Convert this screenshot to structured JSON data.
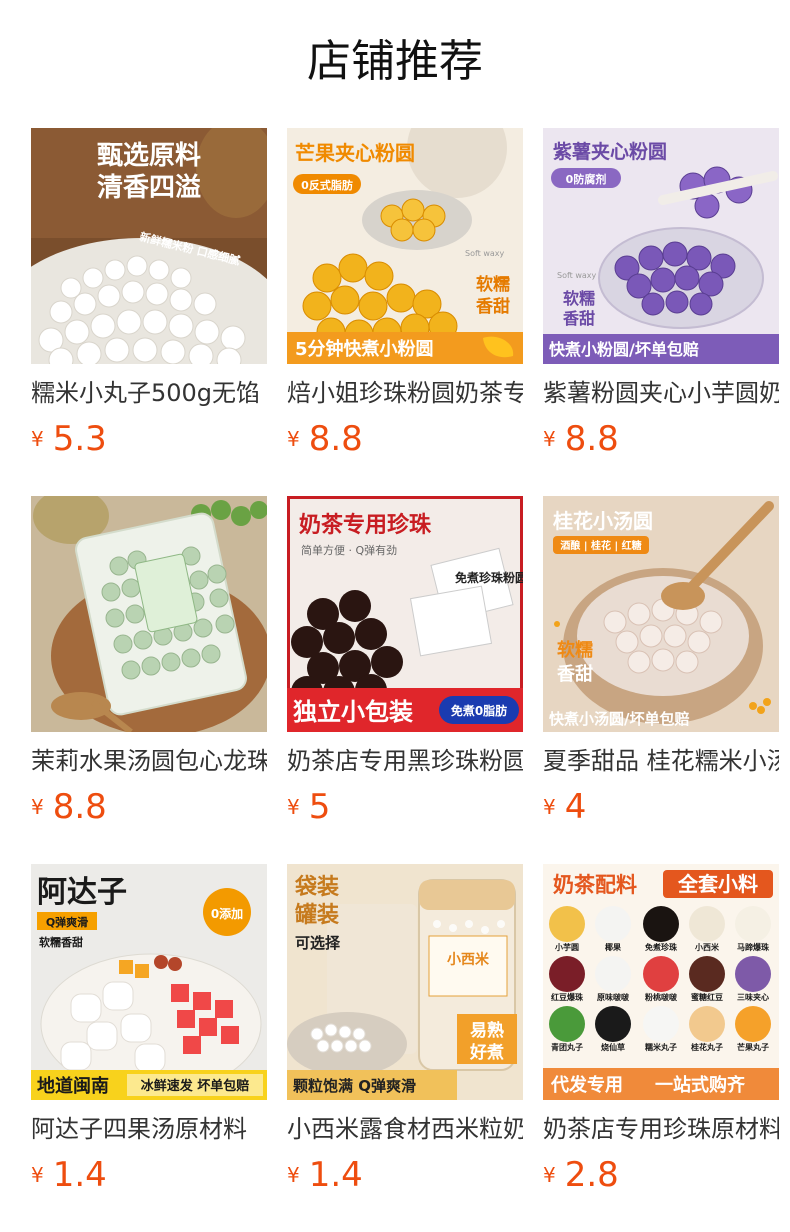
{
  "page": {
    "title": "店铺推荐"
  },
  "currency_symbol": "¥",
  "products": [
    {
      "name": "糯米小丸子500g无馅",
      "price": "5.3",
      "image_text": [
        "甄选原料",
        "清香四溢",
        "新鲜糯米粉 口感细腻"
      ]
    },
    {
      "name": "焙小姐珍珠粉圆奶茶专用",
      "price": "8.8",
      "image_text": [
        "芒果夹心粉圆",
        "0反式脂肪",
        "Soft waxy",
        "软糯",
        "香甜",
        "5分钟快煮小粉圆"
      ]
    },
    {
      "name": "紫薯粉圆夹心小芋圆奶茶",
      "price": "8.8",
      "image_text": [
        "紫薯夹心粉圆",
        "0防腐剂",
        "Soft waxy",
        "软糯",
        "香甜",
        "快煮小粉圆/坏单包赔"
      ]
    },
    {
      "name": "茉莉水果汤圆包心龙珠",
      "price": "8.8",
      "image_text": []
    },
    {
      "name": "奶茶店专用黑珍珠粉圆",
      "price": "5",
      "image_text": [
        "奶茶专用珍珠",
        "简单方便 · Q弹有劲",
        "免煮珍珠粉圆",
        "独立小包装",
        "免煮0脂肪"
      ]
    },
    {
      "name": "夏季甜品 桂花糯米小汤圆",
      "price": "4",
      "image_text": [
        "桂花小汤圆",
        "酒酿 | 桂花 | 红糖",
        "软糯",
        "香甜",
        "快煮小汤圆/坏单包赔"
      ]
    },
    {
      "name": "阿达子四果汤原材料",
      "price": "1.4",
      "image_text": [
        "阿达子",
        "Q弹爽滑",
        "软糯香甜",
        "0添加",
        "地道闽南",
        "冰鲜速发 坏单包赔"
      ]
    },
    {
      "name": "小西米露食材西米粒奶茶",
      "price": "1.4",
      "image_text": [
        "袋装",
        "罐装",
        "可选择",
        "小西米",
        "易熟",
        "好煮",
        "颗粒饱满 Q弹爽滑"
      ]
    },
    {
      "name": "奶茶店专用珍珠原材料",
      "price": "2.8",
      "image_text": [
        "奶茶配料",
        "全套小料",
        "小芋圆",
        "椰果",
        "免煮珍珠",
        "小西米",
        "马蹄爆珠",
        "红豆爆珠",
        "原味啵啵",
        "粉桃啵啵",
        "蜜糖红豆",
        "三味夹心",
        "青团丸子",
        "烧仙草",
        "糯米丸子",
        "桂花丸子",
        "芒果丸子",
        "代发专用",
        "一站式购齐"
      ]
    }
  ],
  "colors": {
    "price": "#ee4d0f",
    "title": "#111111",
    "name": "#333333"
  }
}
